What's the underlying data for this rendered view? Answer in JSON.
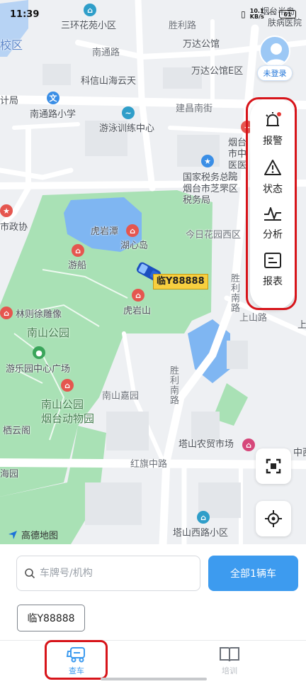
{
  "status_bar": {
    "time": "11:39",
    "network": "10.1\nKB/s",
    "battery": "61"
  },
  "map": {
    "labels": {
      "sanhuan": "三环花苑小区",
      "shengli_road": "胜利路",
      "wanda_plaza": "万达公馆",
      "wanda_plaza_e": "万达公馆E区",
      "nantong_road": "南通路",
      "kexin": "科信山海云天",
      "jianyi_south": "建昌南街",
      "nantong_primary": "南通路小学",
      "swim_center": "游泳训练中心",
      "tax_bureau": "国家税务总局烟台市芝罘区税务局",
      "hospital": "烟台市中医医院",
      "yantai_peninsula": "烟台半岛",
      "gov": "市政协",
      "huyan_tan": "虎岩潭",
      "huxin_island": "湖心岛",
      "youchuan": "游船",
      "huyan_mountain": "虎岩山",
      "jinri_garden": "今日花园西区",
      "shengli_south": "胜利南路",
      "shanshan_road": "上山路",
      "linzexu": "林则徐雕像",
      "nanshan_park": "南山公园",
      "youle_square": "游乐园中心广场",
      "nanshan_zoo": "南山公园\n烟台动物园",
      "nanshan_jiayuan": "南山嘉园",
      "qiyunge": "栖云阁",
      "tashan_market": "塔山农贸市场",
      "hongqi_road": "红旗中路",
      "tashan_west": "塔山西路小区",
      "jisuan": "计局",
      "xiaoqu": "校区",
      "haiyuan": "海园",
      "zhongxi": "中西",
      "shang": "上",
      "ganmin": "肤病医院"
    },
    "vehicle_plate": "临Y88888",
    "amap_logo": "高德地图"
  },
  "user": {
    "login_label": "未登录"
  },
  "function_panel": {
    "items": [
      {
        "label": "报警",
        "icon": "alarm-icon"
      },
      {
        "label": "状态",
        "icon": "warning-icon"
      },
      {
        "label": "分析",
        "icon": "pulse-icon"
      },
      {
        "label": "报表",
        "icon": "report-icon"
      }
    ]
  },
  "search": {
    "placeholder": "车牌号/机构",
    "value": ""
  },
  "all_vehicles_label": "全部1辆车",
  "plate_chip": "临Y88888",
  "tabs": [
    {
      "label": "查车",
      "icon": "truck-icon",
      "active": true
    },
    {
      "label": "培训",
      "icon": "book-icon",
      "active": false
    }
  ],
  "colors": {
    "accent": "#3d9bef",
    "highlight": "#d7141a",
    "park": "#9fdcae",
    "water": "#7fb6f2"
  }
}
